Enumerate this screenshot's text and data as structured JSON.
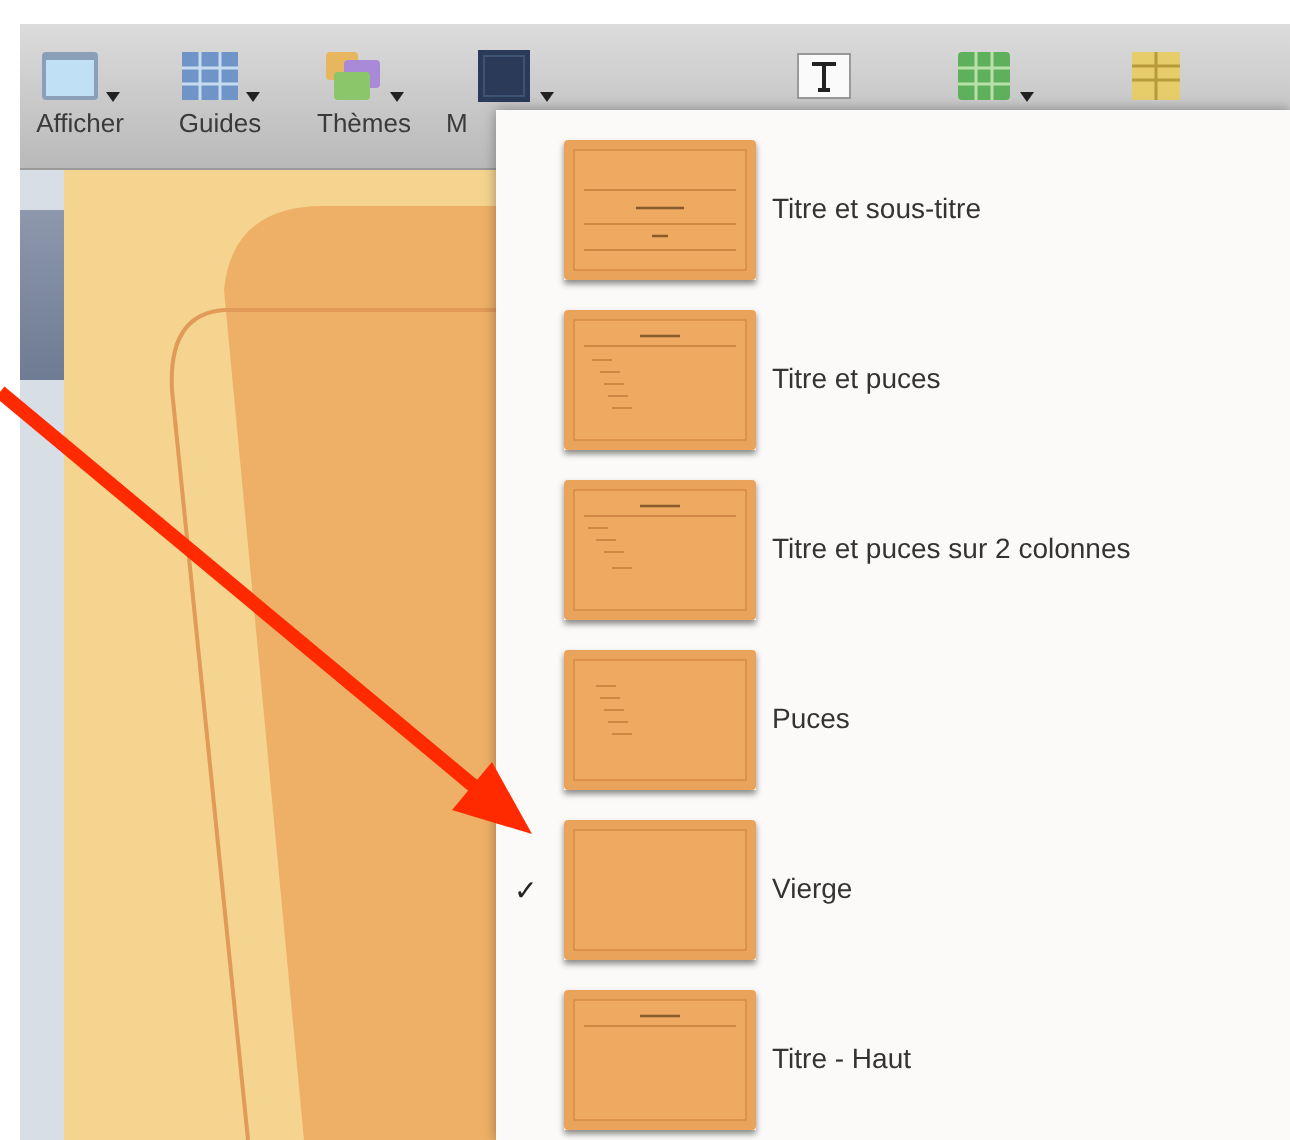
{
  "toolbar": {
    "items": [
      {
        "label": "Afficher",
        "kind": "window",
        "has_menu": true
      },
      {
        "label": "Guides",
        "kind": "grid",
        "has_menu": true
      },
      {
        "label": "Thèmes",
        "kind": "themes",
        "has_menu": true
      },
      {
        "label": "M",
        "kind": "master",
        "has_menu": true
      },
      {
        "kind": "text",
        "has_menu": false
      },
      {
        "kind": "table",
        "has_menu": true
      },
      {
        "kind": "columns",
        "has_menu": false
      }
    ]
  },
  "layout_menu": {
    "check_mark": "✓",
    "items": [
      {
        "label": "Titre et sous-titre",
        "kind": "title-subtitle",
        "checked": false
      },
      {
        "label": "Titre et puces",
        "kind": "title-bullets",
        "checked": false
      },
      {
        "label": "Titre et puces sur 2 colonnes",
        "kind": "two-columns",
        "checked": false
      },
      {
        "label": "Puces",
        "kind": "bullets",
        "checked": false
      },
      {
        "label": "Vierge",
        "kind": "blank",
        "checked": true
      },
      {
        "label": "Titre - Haut",
        "kind": "title-top",
        "checked": false
      }
    ]
  }
}
